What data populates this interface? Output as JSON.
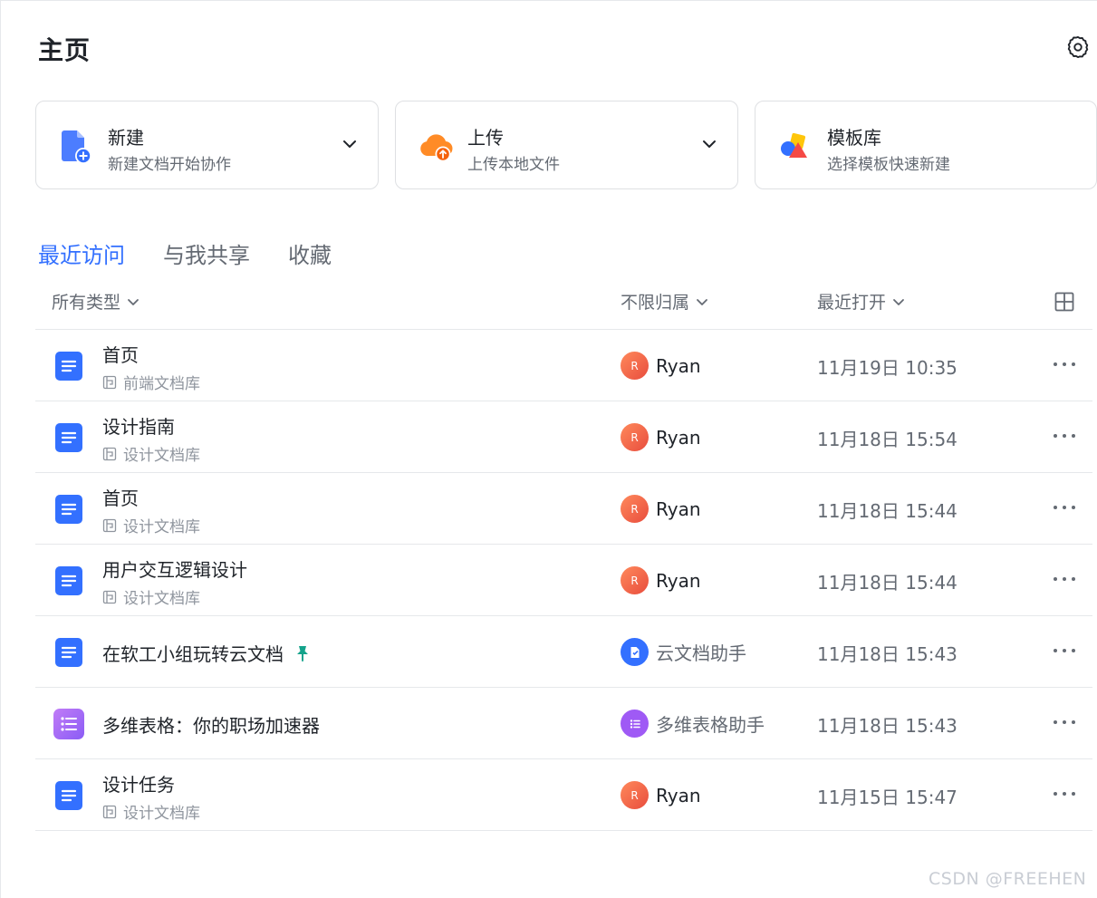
{
  "page": {
    "title": "主页"
  },
  "icons": {
    "settings": "gear-icon",
    "view_toggle": "grid-icon",
    "more": "more-icon",
    "pin": "pin-icon",
    "space": "space-icon"
  },
  "colors": {
    "accent": "#3370ff",
    "doc_icon": "#3370ff",
    "bitable_icon": "#9f5af5",
    "pin": "#14a38b"
  },
  "actions": [
    {
      "title": "新建",
      "subtitle": "新建文档开始协作",
      "icon": "new-doc-icon",
      "has_dropdown": true
    },
    {
      "title": "上传",
      "subtitle": "上传本地文件",
      "icon": "upload-cloud-icon",
      "has_dropdown": true
    },
    {
      "title": "模板库",
      "subtitle": "选择模板快速新建",
      "icon": "template-icon",
      "has_dropdown": false
    }
  ],
  "tabs": [
    {
      "label": "最近访问",
      "active": true
    },
    {
      "label": "与我共享",
      "active": false
    },
    {
      "label": "收藏",
      "active": false
    }
  ],
  "filters": {
    "type": "所有类型",
    "owner": "不限归属",
    "sort": "最近打开"
  },
  "rows": [
    {
      "name": "首页",
      "space": "前端文档库",
      "owner": "Ryan",
      "avatar": "R",
      "time": "11月19日 10:35",
      "kind": "doc"
    },
    {
      "name": "设计指南",
      "space": "设计文档库",
      "owner": "Ryan",
      "avatar": "R",
      "time": "11月18日 15:54",
      "kind": "doc"
    },
    {
      "name": "首页",
      "space": "设计文档库",
      "owner": "Ryan",
      "avatar": "R",
      "time": "11月18日 15:44",
      "kind": "doc"
    },
    {
      "name": "用户交互逻辑设计",
      "space": "设计文档库",
      "owner": "Ryan",
      "avatar": "R",
      "time": "11月18日 15:44",
      "kind": "doc"
    },
    {
      "name": "在软工小组玩转云文档",
      "space": "",
      "owner": "云文档助手",
      "avatar": "",
      "time": "11月18日 15:43",
      "kind": "doc",
      "pinned": true
    },
    {
      "name": "多维表格：你的职场加速器",
      "space": "",
      "owner": "多维表格助手",
      "avatar": "",
      "time": "11月18日 15:43",
      "kind": "bitable"
    },
    {
      "name": "设计任务",
      "space": "设计文档库",
      "owner": "Ryan",
      "avatar": "R",
      "time": "11月15日 15:47",
      "kind": "doc"
    }
  ],
  "watermark": "CSDN @FREEHEN"
}
